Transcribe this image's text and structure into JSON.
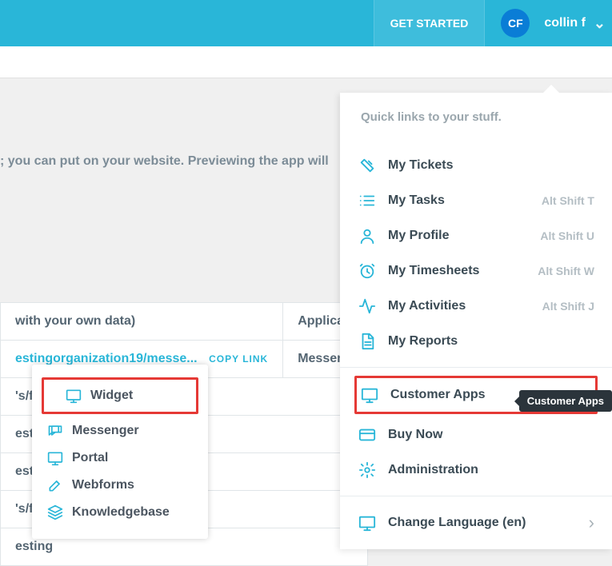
{
  "header": {
    "get_started": "GET STARTED",
    "avatar": "CF",
    "username": "collin f"
  },
  "hint": "; you can put on your website. Previewing the app will",
  "table": {
    "col1": "with your own data)",
    "col2": "Applicati",
    "url": "estingorganization19/messe...",
    "copy": "COPY LINK",
    "cell2": "Messeng",
    "rows": [
      "'s/fse",
      "esting",
      "esting",
      "'s/fse",
      "esting"
    ]
  },
  "mini": {
    "items": [
      "Widget",
      "Messenger",
      "Portal",
      "Webforms",
      "Knowledgebase"
    ]
  },
  "drop": {
    "head": "Quick links to your stuff.",
    "tickets": {
      "label": "My Tickets",
      "shortcut": ""
    },
    "tasks": {
      "label": "My Tasks",
      "shortcut": "Alt Shift T"
    },
    "profile": {
      "label": "My Profile",
      "shortcut": "Alt Shift U"
    },
    "timesheets": {
      "label": "My Timesheets",
      "shortcut": "Alt Shift W"
    },
    "activities": {
      "label": "My Activities",
      "shortcut": "Alt Shift J"
    },
    "reports": {
      "label": "My Reports",
      "shortcut": ""
    },
    "customer_apps": {
      "label": "Customer Apps"
    },
    "buy": {
      "label": "Buy Now"
    },
    "admin": {
      "label": "Administration"
    },
    "lang": {
      "label": "Change Language (en)"
    }
  },
  "tooltip": "Customer Apps"
}
